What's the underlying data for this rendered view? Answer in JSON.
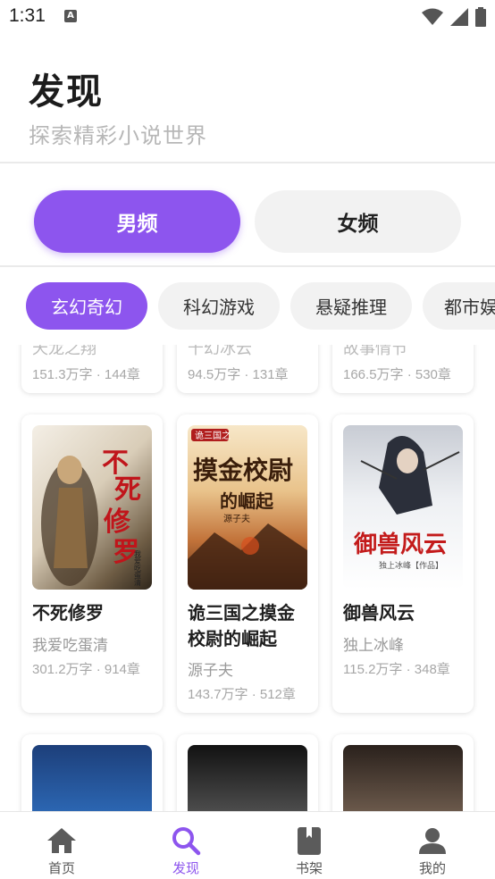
{
  "status_bar": {
    "time": "1:31",
    "notification_icon": "a-letter-icon",
    "icons": [
      "wifi-icon",
      "cellular-signal-icon",
      "battery-icon"
    ]
  },
  "header": {
    "title": "发现",
    "subtitle": "探索精彩小说世界"
  },
  "gender_tabs": [
    {
      "label": "男频",
      "active": true
    },
    {
      "label": "女频",
      "active": false
    }
  ],
  "categories": [
    {
      "label": "玄幻奇幻",
      "active": true
    },
    {
      "label": "科幻游戏",
      "active": false
    },
    {
      "label": "悬疑推理",
      "active": false
    },
    {
      "label": "都市娱乐",
      "active": false
    }
  ],
  "books_partial_top": [
    {
      "title": "天龙之翔",
      "meta": "151.3万字 · 144章"
    },
    {
      "title": "千幻冰云",
      "meta": "94.5万字 · 131章"
    },
    {
      "title": "故事情节",
      "meta": "166.5万字 · 530章"
    }
  ],
  "books": [
    {
      "title": "不死修罗",
      "author": "我爱吃蛋清",
      "meta": "301.2万字 · 914章",
      "cover_text": "不死修罗",
      "cover_sub": "我爱吃蛋清"
    },
    {
      "title": "诡三国之摸金校尉的崛起",
      "author": "源子夫",
      "meta": "143.7万字 · 512章",
      "cover_text": "摸金校尉",
      "cover_sub": "源子夫"
    },
    {
      "title": "御兽风云",
      "author": "独上冰峰",
      "meta": "115.2万字 · 348章",
      "cover_text": "御兽风云",
      "cover_sub": "独上冰峰【作品】"
    }
  ],
  "bottom_nav": [
    {
      "label": "首页",
      "icon": "home-icon",
      "active": false
    },
    {
      "label": "发现",
      "icon": "search-icon",
      "active": true
    },
    {
      "label": "书架",
      "icon": "book-icon",
      "active": false
    },
    {
      "label": "我的",
      "icon": "person-icon",
      "active": false
    }
  ],
  "colors": {
    "accent": "#8d55ee",
    "chip_inactive": "#f2f2f2",
    "muted_text": "#a7a7a7"
  }
}
